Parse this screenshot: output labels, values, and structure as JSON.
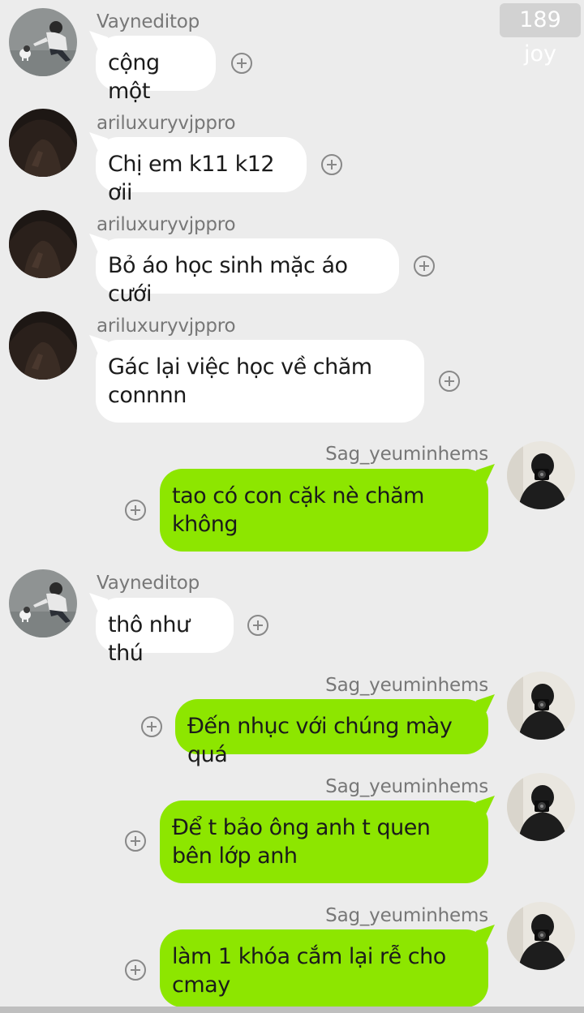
{
  "header": {
    "badge": "189 joy"
  },
  "messages": [
    {
      "sender": "Vayneditop",
      "text": "cộng một",
      "direction": "incoming",
      "avatar": "cat-photo-avatar"
    },
    {
      "sender": "ariluxuryvjppro",
      "text": "Chị em k11 k12 ơii",
      "direction": "incoming",
      "avatar": "dark-photo-avatar"
    },
    {
      "sender": "ariluxuryvjppro",
      "text": "Bỏ áo học sinh mặc áo cưới",
      "direction": "incoming",
      "avatar": "dark-photo-avatar"
    },
    {
      "sender": "ariluxuryvjppro",
      "text": "Gác lại việc học về chăm connnn",
      "direction": "incoming",
      "avatar": "dark-photo-avatar"
    },
    {
      "sender": "Sag_yeuminhems",
      "text": "tao có con cặk nè chăm không",
      "direction": "outgoing",
      "avatar": "camera-selfie-avatar"
    },
    {
      "sender": "Vayneditop",
      "text": "thô như thú",
      "direction": "incoming",
      "avatar": "cat-photo-avatar"
    },
    {
      "sender": "Sag_yeuminhems",
      "text": "Đến nhục với chúng mày quá",
      "direction": "outgoing",
      "avatar": "camera-selfie-avatar"
    },
    {
      "sender": "Sag_yeuminhems",
      "text": "Để t bảo ông anh t quen bên lớp anh",
      "direction": "outgoing",
      "avatar": "camera-selfie-avatar"
    },
    {
      "sender": "Sag_yeuminhems",
      "text": "làm 1 khóa cắm lại rễ cho cmay",
      "direction": "outgoing",
      "avatar": "camera-selfie-avatar"
    }
  ],
  "colors": {
    "background": "#ececec",
    "incoming_bubble": "#ffffff",
    "outgoing_bubble": "#8de600",
    "sender_name": "#777777",
    "react_icon": "#888888"
  }
}
